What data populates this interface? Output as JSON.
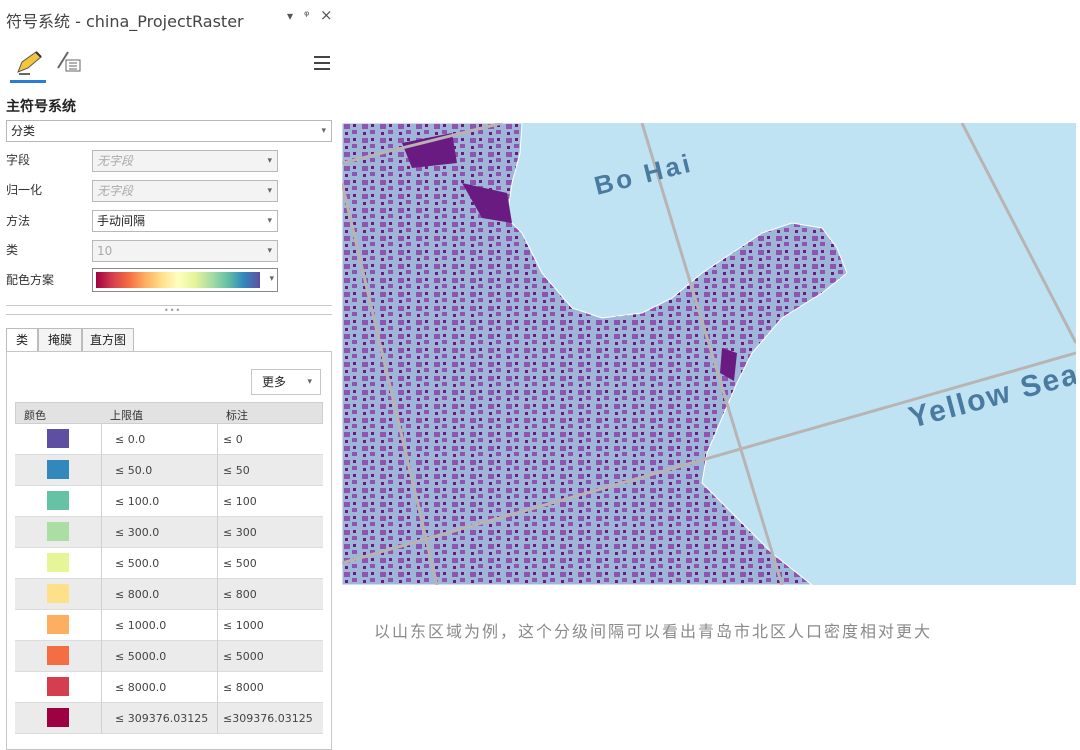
{
  "pane": {
    "title": "符号系统 - china_ProjectRaster",
    "btn_dropdown": "▾",
    "btn_pin": "ᵠ",
    "btn_close": "×",
    "section_title": "主符号系统",
    "renderer": "分类",
    "fields": [
      {
        "label": "字段",
        "value": "无字段"
      },
      {
        "label": "归一化",
        "value": "无字段"
      },
      {
        "label": "方法",
        "value": "手动间隔"
      },
      {
        "label": "类",
        "value": "10"
      },
      {
        "label": "配色方案",
        "value": ""
      }
    ],
    "subtabs": [
      "类",
      "掩膜",
      "直方图"
    ],
    "more_label": "更多",
    "columns": [
      "颜色",
      "上限值",
      "标注"
    ],
    "classes": [
      {
        "color": "#5e4fa2",
        "upper": "≤  0.0",
        "label": "≤ 0"
      },
      {
        "color": "#3288bd",
        "upper": "≤  50.0",
        "label": "≤ 50"
      },
      {
        "color": "#66c2a5",
        "upper": "≤  100.0",
        "label": "≤ 100"
      },
      {
        "color": "#abdda4",
        "upper": "≤  300.0",
        "label": "≤ 300"
      },
      {
        "color": "#e6f598",
        "upper": "≤  500.0",
        "label": "≤ 500"
      },
      {
        "color": "#fee08b",
        "upper": "≤  800.0",
        "label": "≤ 800"
      },
      {
        "color": "#fdae61",
        "upper": "≤  1000.0",
        "label": "≤ 1000"
      },
      {
        "color": "#f46d43",
        "upper": "≤  5000.0",
        "label": "≤ 5000"
      },
      {
        "color": "#d53e4f",
        "upper": "≤  8000.0",
        "label": "≤ 8000"
      },
      {
        "color": "#9e0142",
        "upper": "≤  309376.03125",
        "label": "≤309376.03125"
      }
    ]
  },
  "map": {
    "label_bohai": "Bo Hai",
    "label_yellow_sea": "Yellow Sea",
    "sea_color": "#bfe3f3",
    "land_light": "#9fb6d8",
    "land_purple": "#8e55b0",
    "land_dark": "#6a1b82"
  },
  "caption": "以山东区域为例，这个分级间隔可以看出青岛市北区人口密度相对更大"
}
